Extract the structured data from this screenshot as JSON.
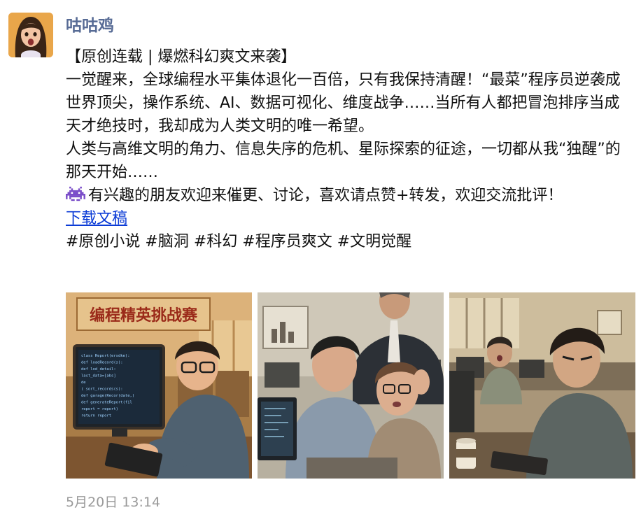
{
  "post": {
    "author": "咕咕鸡",
    "title_line": "【原创连载 | 爆燃科幻爽文来袭】",
    "paragraph_1": "一觉醒来，全球编程水平集体退化一百倍，只有我保持清醒！“最菜”程序员逆袭成世界顶尖，操作系统、AI、数据可视化、维度战争……当所有人都把冒泡排序当成天才绝技时，我却成为人类文明的唯一希望。",
    "paragraph_2": "人类与高维文明的角力、信息失序的危机、星际探索的征途，一切都从我“独醒”的那天开始……",
    "paragraph_3": "有兴趣的朋友欢迎来催更、讨论，喜欢请点赞+转发，欢迎交流批评！",
    "download_link": "下载文稿",
    "hashtags": "#原创小说 #脑洞 #科幻 #程序员爽文 #文明觉醒",
    "timestamp": "5月20日 13:14"
  },
  "images": {
    "image_1": {
      "banner_text": "编程精英挑战赛",
      "code_lines": [
        "class Report(ersdke):",
        "  def loadRecord(s):",
        "    def lod_detail:",
        "      last_data=[abs]",
        "    de",
        "  ( sort_records(s):",
        "  def garage(Recor(date,)",
        "  def generateReport(fil",
        "    report = report)",
        "  return report"
      ]
    }
  },
  "icons": {
    "avatar": "girl-avatar",
    "emoji": "space-invader-icon"
  },
  "colors": {
    "author_name": "#576b95",
    "link": "#0b3bd6",
    "timestamp": "#9a9a9a",
    "emoji": "#7a4dc9"
  }
}
